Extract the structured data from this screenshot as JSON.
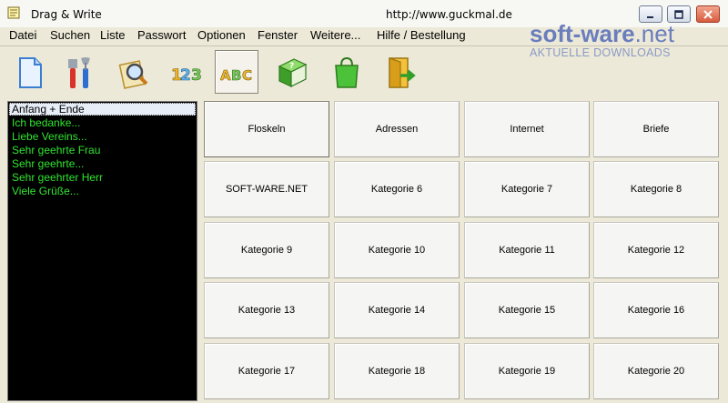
{
  "window": {
    "title": "Drag & Write",
    "url": "http://www.guckmal.de"
  },
  "menu": [
    "Datei",
    "Suchen",
    "Liste",
    "Passwort",
    "Optionen",
    "Fenster",
    "Weitere...",
    "Hilfe / Bestellung"
  ],
  "logo": {
    "main": "soft-ware",
    "tld": ".net",
    "tagline": "AKTUELLE DOWNLOADS"
  },
  "toolbar": [
    "new-document-icon",
    "tools-icon",
    "search-document-icon",
    "numbers-icon",
    "abc-icon",
    "help-book-icon",
    "shopping-bag-icon",
    "exit-door-icon"
  ],
  "list": {
    "items": [
      "Anfang + Ende",
      "Ich bedanke...",
      "Liebe Vereins...",
      "Sehr geehrte Frau",
      "Sehr geehrte...",
      "Sehr geehrter Herr",
      "Viele Grüße..."
    ],
    "selected_index": 0
  },
  "categories": [
    "Floskeln",
    "Adressen",
    "Internet",
    "Briefe",
    "SOFT-WARE.NET",
    "Kategorie 6",
    "Kategorie 7",
    "Kategorie 8",
    "Kategorie 9",
    "Kategorie 10",
    "Kategorie 11",
    "Kategorie 12",
    "Kategorie 13",
    "Kategorie 14",
    "Kategorie 15",
    "Kategorie 16",
    "Kategorie 17",
    "Kategorie 18",
    "Kategorie 19",
    "Kategorie 20"
  ],
  "colors": {
    "list_text": "#2fe52f",
    "list_background": "#000000",
    "logo": "#6a7dbd"
  }
}
